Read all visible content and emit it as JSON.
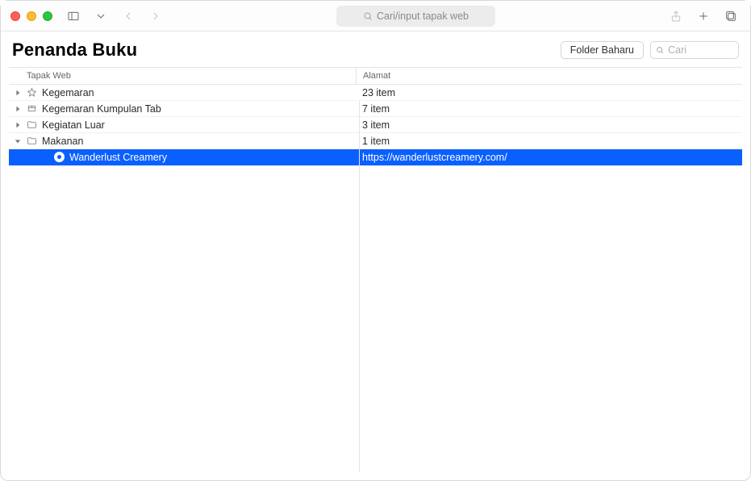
{
  "toolbar": {
    "address_placeholder": "Cari/input tapak web"
  },
  "header": {
    "title": "Penanda Buku",
    "new_folder_label": "Folder Baharu",
    "search_placeholder": "Cari"
  },
  "columns": {
    "name": "Tapak Web",
    "address": "Alamat"
  },
  "rows": [
    {
      "icon": "star",
      "expand": "right",
      "indent": 0,
      "name": "Kegemaran",
      "addr": "23 item",
      "selected": false
    },
    {
      "icon": "tabgrp",
      "expand": "right",
      "indent": 0,
      "name": "Kegemaran Kumpulan Tab",
      "addr": "7 item",
      "selected": false
    },
    {
      "icon": "folder",
      "expand": "right",
      "indent": 0,
      "name": "Kegiatan Luar",
      "addr": "3 item",
      "selected": false
    },
    {
      "icon": "folder",
      "expand": "down",
      "indent": 0,
      "name": "Makanan",
      "addr": "1 item",
      "selected": false
    },
    {
      "icon": "site",
      "expand": "none",
      "indent": 1,
      "name": "Wanderlust Creamery",
      "addr": "https://wanderlustcreamery.com/",
      "selected": true
    }
  ]
}
